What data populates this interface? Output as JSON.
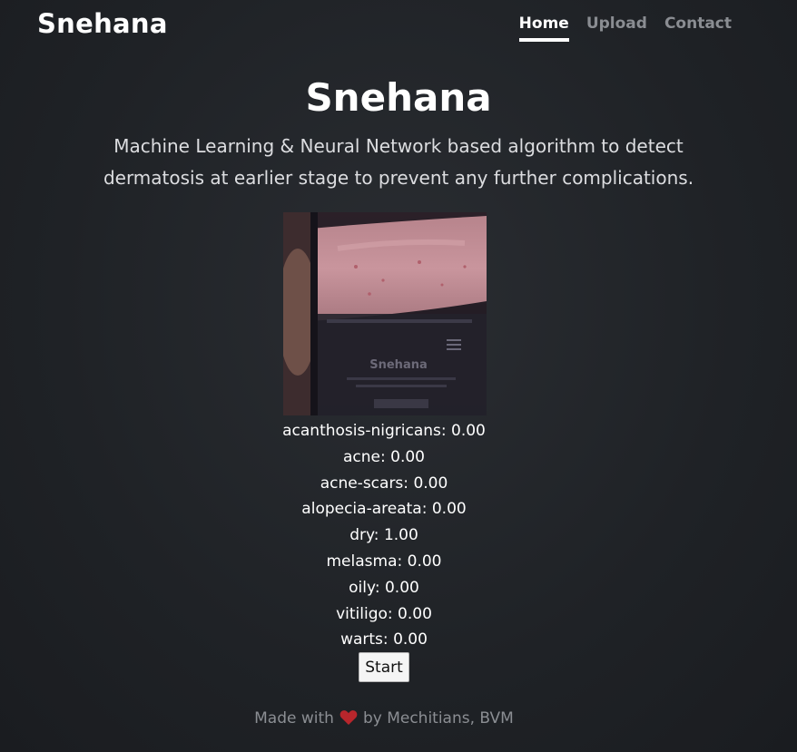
{
  "navbar": {
    "brand": "Snehana",
    "links": [
      {
        "label": "Home",
        "active": true
      },
      {
        "label": "Upload",
        "active": false
      },
      {
        "label": "Contact",
        "active": false
      }
    ]
  },
  "hero": {
    "title": "Snehana",
    "subtitle": "Machine Learning & Neural Network based algorithm to detect dermatosis at earlier stage to prevent any further complications."
  },
  "preview": {
    "overlay_text": "Snehana"
  },
  "results": [
    {
      "label": "acanthosis-nigricans",
      "score": "0.00"
    },
    {
      "label": "acne",
      "score": "0.00"
    },
    {
      "label": "acne-scars",
      "score": "0.00"
    },
    {
      "label": "alopecia-areata",
      "score": "0.00"
    },
    {
      "label": "dry",
      "score": "1.00"
    },
    {
      "label": "melasma",
      "score": "0.00"
    },
    {
      "label": "oily",
      "score": "0.00"
    },
    {
      "label": "vitiligo",
      "score": "0.00"
    },
    {
      "label": "warts",
      "score": "0.00"
    }
  ],
  "start_button": {
    "label": "Start"
  },
  "footer": {
    "prefix": "Made with",
    "icon": "heart-icon",
    "suffix": "by Mechitians, BVM",
    "heart_color": "#c0282d"
  },
  "colors": {
    "background": "#212428",
    "text": "#ffffff",
    "muted": "#8a8d92"
  }
}
